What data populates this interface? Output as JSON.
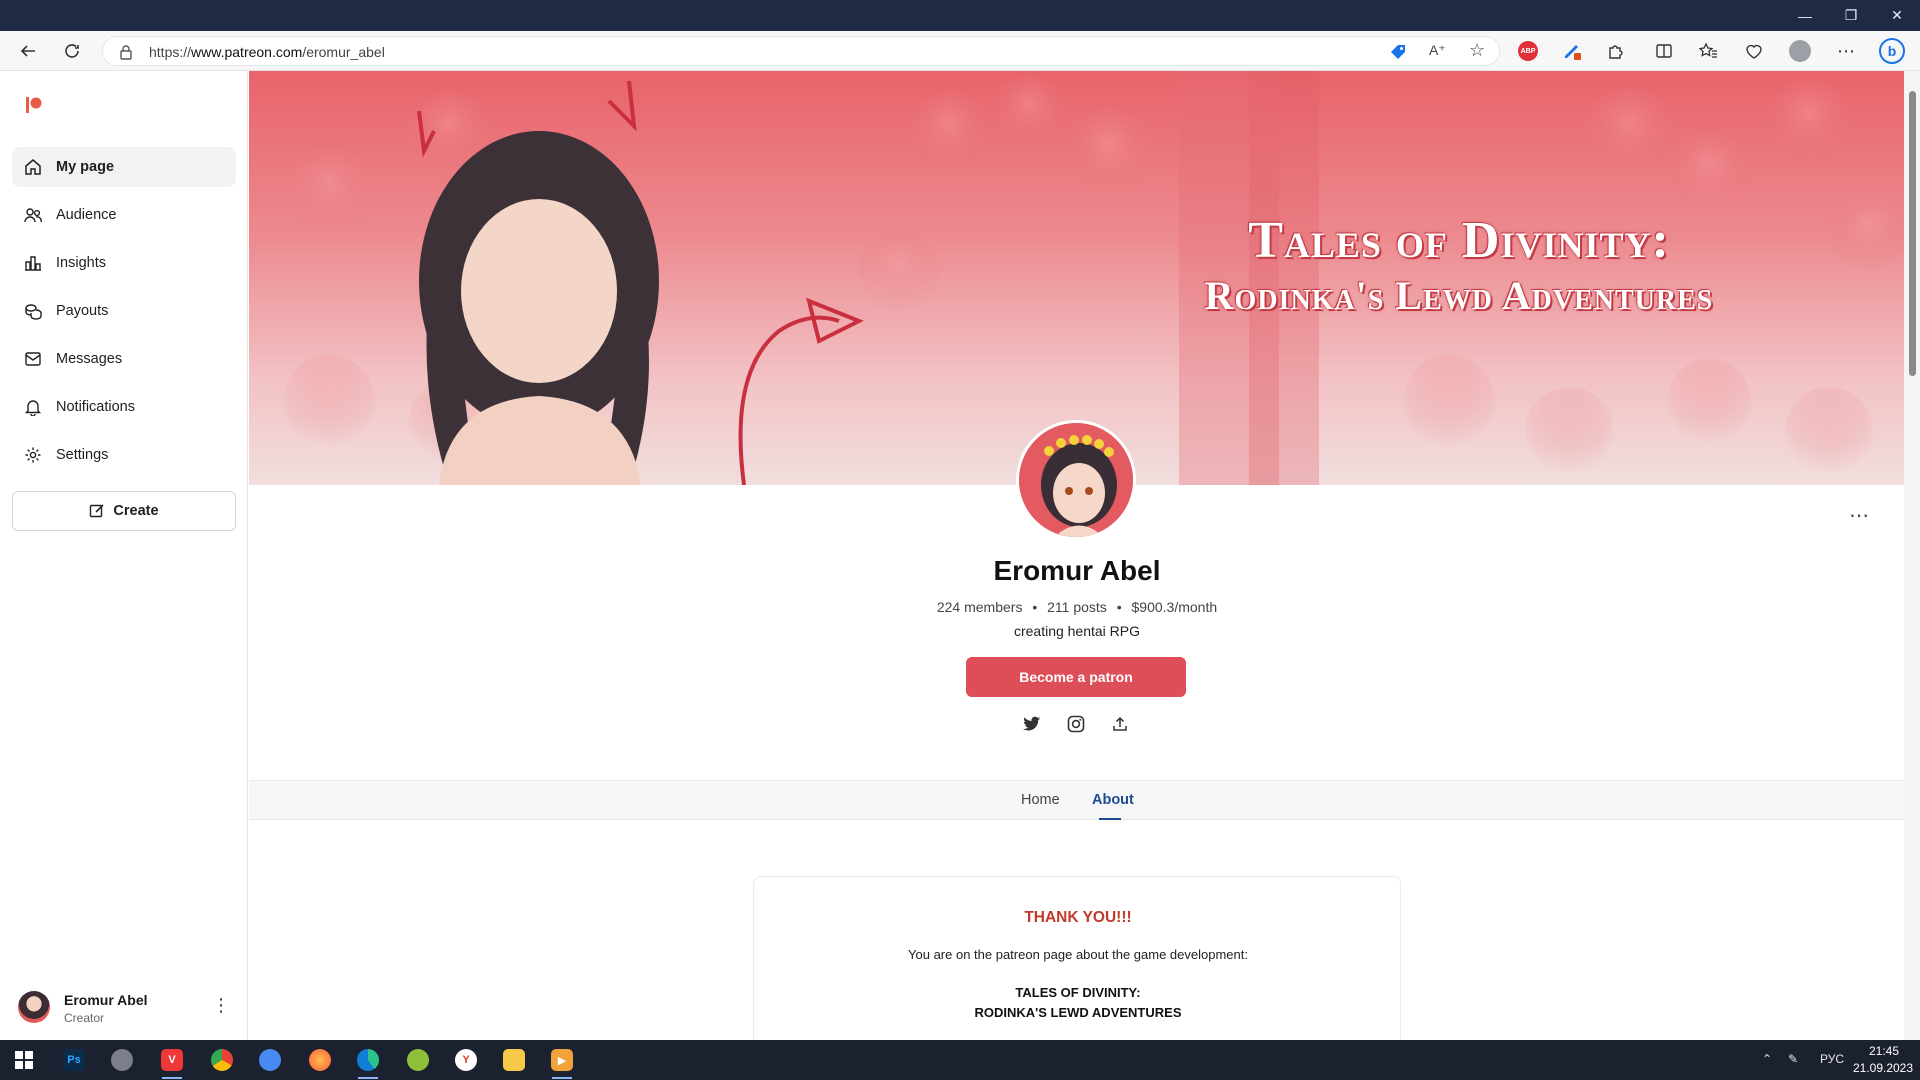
{
  "browser": {
    "url_prefix": "https://",
    "url_host": "www.patreon.com",
    "url_path": "/eromur_abel"
  },
  "sidebar": {
    "items": [
      {
        "label": "My page",
        "icon": "home-icon",
        "active": true
      },
      {
        "label": "Audience",
        "icon": "people-icon"
      },
      {
        "label": "Insights",
        "icon": "chart-icon"
      },
      {
        "label": "Payouts",
        "icon": "coins-icon"
      },
      {
        "label": "Messages",
        "icon": "mail-icon"
      },
      {
        "label": "Notifications",
        "icon": "bell-icon"
      },
      {
        "label": "Settings",
        "icon": "gear-icon"
      }
    ],
    "create_label": "Create",
    "user": {
      "name": "Eromur Abel",
      "role": "Creator"
    }
  },
  "banner": {
    "title_line1": "Tales of Divinity:",
    "title_line2": "Rodinka's Lewd Adventures"
  },
  "profile": {
    "name": "Eromur Abel",
    "members": "224 members",
    "posts": "211 posts",
    "earnings": "$900.3/month",
    "separator": "•",
    "tagline": "creating hentai RPG",
    "cta": "Become a patron"
  },
  "tabs": [
    {
      "label": "Home"
    },
    {
      "label": "About",
      "active": true
    }
  ],
  "about": {
    "heading": "THANK YOU!!!",
    "intro": "You are on the patreon page about the game development:",
    "game_line1": "TALES OF DIVINITY:",
    "game_line2": "RODINKA'S LEWD ADVENTURES"
  },
  "taskbar": {
    "lang": "РУС",
    "time": "21:45",
    "date": "21.09.2023"
  },
  "colors": {
    "brand": "#de4e58",
    "tab_active": "#1e4c8f",
    "heading_red": "#c0392b"
  }
}
